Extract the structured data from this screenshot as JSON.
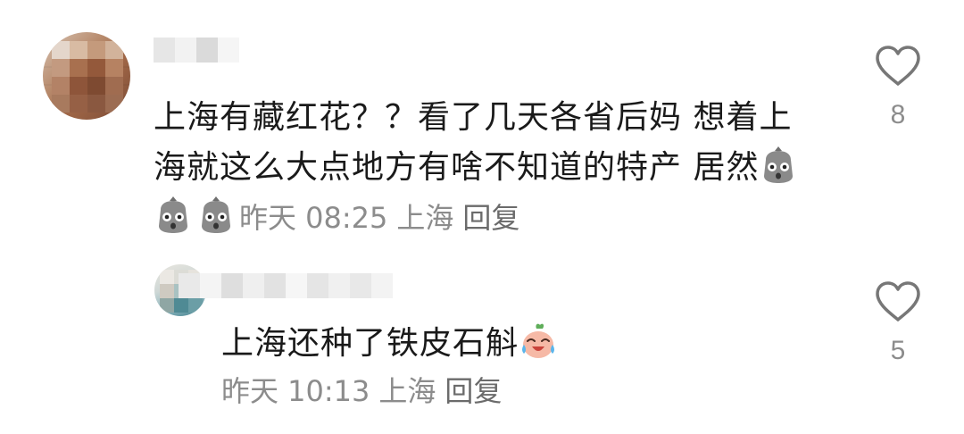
{
  "comments": [
    {
      "text": "上海有藏红花？？看了几天各省后妈 想着上海就这么大点地方有啥不知道的特产 居然",
      "emoji": [
        "shocked-face-emoji",
        "shocked-face-emoji",
        "shocked-face-emoji"
      ],
      "time": "昨天 08:25",
      "location": "上海",
      "reply_label": "回复",
      "likes": "8"
    },
    {
      "text": "上海还种了铁皮石斛",
      "emoji": [
        "crying-laughing-emoji"
      ],
      "time": "昨天 10:13",
      "location": "上海",
      "reply_label": "回复",
      "likes": "5"
    }
  ],
  "colors": {
    "text": "#1a1a1a",
    "meta": "#8c8c8c",
    "heart_outline": "#777777"
  },
  "icons": [
    "heart-outline-icon"
  ]
}
